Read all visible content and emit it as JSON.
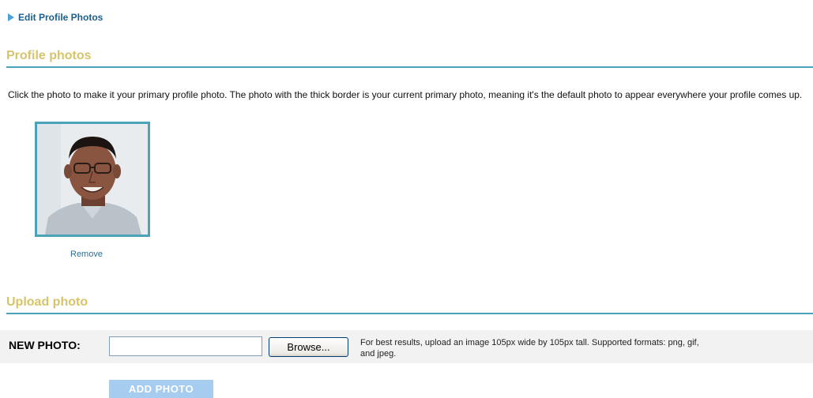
{
  "breadcrumb": {
    "label": "Edit Profile Photos"
  },
  "profile_section": {
    "title": "Profile photos",
    "description": "Click the photo to make it your primary profile photo. The photo with the thick border is your current primary photo, meaning it's the default photo to appear everywhere your profile comes up.",
    "photos": [
      {
        "is_primary": true,
        "remove_label": "Remove"
      }
    ]
  },
  "upload_section": {
    "title": "Upload photo",
    "new_photo_label": "NEW PHOTO:",
    "file_input_value": "",
    "browse_label": "Browse...",
    "hint_line1": "For best results, upload an image 105px wide by 105px tall. Supported formats: png, gif,",
    "hint_line2": "and jpeg.",
    "add_button_label": "ADD PHOTO"
  },
  "colors": {
    "section_title": "#d7c46a",
    "section_rule": "#4aa3b8",
    "link": "#1d5f8a",
    "photo_border": "#4aa3b8",
    "add_button_bg": "#a6ccf0",
    "upload_row_bg": "#f2f2f2"
  }
}
